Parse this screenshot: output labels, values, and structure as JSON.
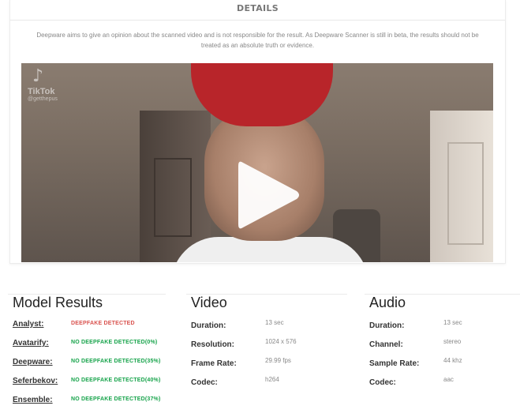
{
  "details": {
    "title": "DETAILS",
    "disclaimer": "Deepware aims to give an opinion about the scanned video and is not responsible for the result. As Deepware Scanner is still in beta, the results should not be treated as an absolute truth or evidence."
  },
  "video_player": {
    "watermark_brand": "TikTok",
    "watermark_user": "@getthepus",
    "play_icon": "play-icon"
  },
  "model_results": {
    "title": "Model Results",
    "items": [
      {
        "label": "Analyst:",
        "result": "DEEPFAKE DETECTED",
        "status": "deepfake"
      },
      {
        "label": "Avatarify:",
        "result": "NO DEEPFAKE DETECTED(0%)",
        "status": "clean"
      },
      {
        "label": "Deepware:",
        "result": "NO DEEPFAKE DETECTED(35%)",
        "status": "clean"
      },
      {
        "label": "Seferbekov:",
        "result": "NO DEEPFAKE DETECTED(40%)",
        "status": "clean"
      },
      {
        "label": "Ensemble:",
        "result": "NO DEEPFAKE DETECTED(37%)",
        "status": "clean"
      }
    ]
  },
  "video_info": {
    "title": "Video",
    "items": [
      {
        "label": "Duration:",
        "value": "13 sec"
      },
      {
        "label": "Resolution:",
        "value": "1024 x 576"
      },
      {
        "label": "Frame Rate:",
        "value": "29.99 fps"
      },
      {
        "label": "Codec:",
        "value": "h264"
      }
    ]
  },
  "audio_info": {
    "title": "Audio",
    "items": [
      {
        "label": "Duration:",
        "value": "13 sec"
      },
      {
        "label": "Channel:",
        "value": "stereo"
      },
      {
        "label": "Sample Rate:",
        "value": "44 khz"
      },
      {
        "label": "Codec:",
        "value": "aac"
      }
    ]
  },
  "colors": {
    "deepfake": "#d9534f",
    "clean": "#16a34a"
  }
}
